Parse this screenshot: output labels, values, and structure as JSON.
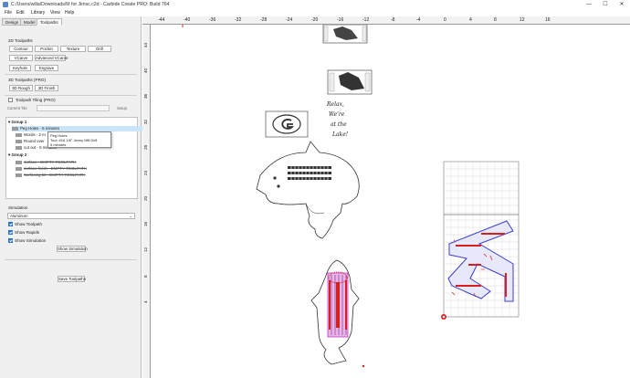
{
  "window": {
    "title": "C:/Users/willa/Downloads/M for Jimsc.c2d - Carbide Create PRO: Build 764",
    "min": "—",
    "max": "☐",
    "close": "✕"
  },
  "menu": [
    "File",
    "Edit",
    "Library",
    "View",
    "Help"
  ],
  "tabs": [
    "Design",
    "Model",
    "Toolpaths"
  ],
  "active_tab": "Toolpaths",
  "toolpaths_2d": {
    "label": "2D Toolpaths",
    "buttons": [
      "Contour",
      "Pocket",
      "Texture",
      "Drill",
      "VCarve",
      "Advanced VCarve",
      "Keyhole",
      "Engrave"
    ]
  },
  "toolpaths_3d": {
    "label": "3D Toolpaths (PRO)",
    "buttons": [
      "3D Rough",
      "3D Finish"
    ]
  },
  "tiling": {
    "label": "Toolpath Tiling (PRO)",
    "current_tile": "Current Tile",
    "setup": "Setup"
  },
  "toolpath_list": {
    "group1": "Group 1",
    "items1": [
      "Peg Holes - 5 minutes",
      "Words - 2 m",
      "Round over",
      "cut out - 5 minutes"
    ],
    "group2": "Group 2",
    "items2": [
      "surface - EMPTY TOOLPATH",
      "surface finish - EMPTY TOOLPATH",
      "Surfacing bit - EMPTY TOOLPATH"
    ]
  },
  "tooltip": {
    "line1": "Peg Holes",
    "line2": "Tool: #16 1/8\" Jenny Mill Drill",
    "line3": "5 minutes"
  },
  "simulation": {
    "label": "Simulation",
    "material": "Aluminum",
    "show_toolpath": "Show Toolpath",
    "show_rapids": "Show Rapids",
    "show_simulation": "Show Simulation",
    "show_sim_button": "Show Simulation"
  },
  "save_button": "Save Toolpaths",
  "ruler": {
    "top": [
      "-44",
      "-40",
      "-36",
      "-32",
      "-28",
      "-24",
      "-20",
      "-16",
      "-12",
      "-8",
      "-4",
      "0",
      "4",
      "8",
      "12",
      "16"
    ],
    "left": [
      "44",
      "40",
      "36",
      "32",
      "28",
      "24",
      "20",
      "16",
      "12",
      "8",
      "4"
    ]
  },
  "canvas_text": [
    "Relax,",
    "We're",
    "at the",
    "Lake!"
  ],
  "colors": {
    "toolpath_red": "#d61f1f",
    "toolpath_blue": "#3b3bd6",
    "sim_purple": "#c43cc4",
    "accent": "#2a72c6"
  }
}
